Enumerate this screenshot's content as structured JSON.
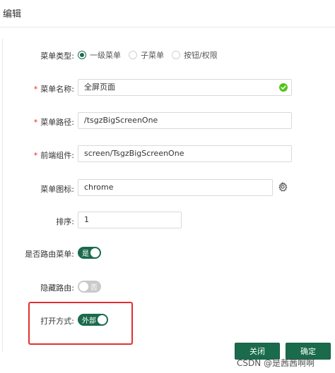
{
  "dialog": {
    "title": "编辑"
  },
  "form": {
    "menu_type": {
      "label": "菜单类型:",
      "options": [
        {
          "label": "一级菜单",
          "checked": true
        },
        {
          "label": "子菜单",
          "checked": false
        },
        {
          "label": "按钮/权限",
          "checked": false
        }
      ]
    },
    "menu_name": {
      "required_mark": "*",
      "label": "菜单名称:",
      "value": "全屏页面"
    },
    "menu_path": {
      "required_mark": "*",
      "label": "菜单路径:",
      "value": "/tsgzBigScreenOne"
    },
    "frontend_component": {
      "required_mark": "*",
      "label": "前端组件:",
      "value": "screen/TsgzBigScreenOne"
    },
    "menu_icon": {
      "label": "菜单图标:",
      "value": "chrome"
    },
    "sort": {
      "label": "排序:",
      "value": "1"
    },
    "is_route": {
      "label": "是否路由菜单:",
      "switch_text": "是",
      "on": true
    },
    "hide_route": {
      "label": "隐藏路由:",
      "switch_text": "否",
      "on": false
    },
    "open_mode": {
      "label": "打开方式:",
      "switch_text": "外部",
      "on": true
    }
  },
  "footer": {
    "close_label": "关闭",
    "confirm_label": "确定"
  },
  "watermark": "CSDN @是茜茜啊啊",
  "colors": {
    "primary": "#1a6b4c",
    "success": "#52c41a",
    "required": "#f5222d",
    "highlight": "#e03030"
  }
}
